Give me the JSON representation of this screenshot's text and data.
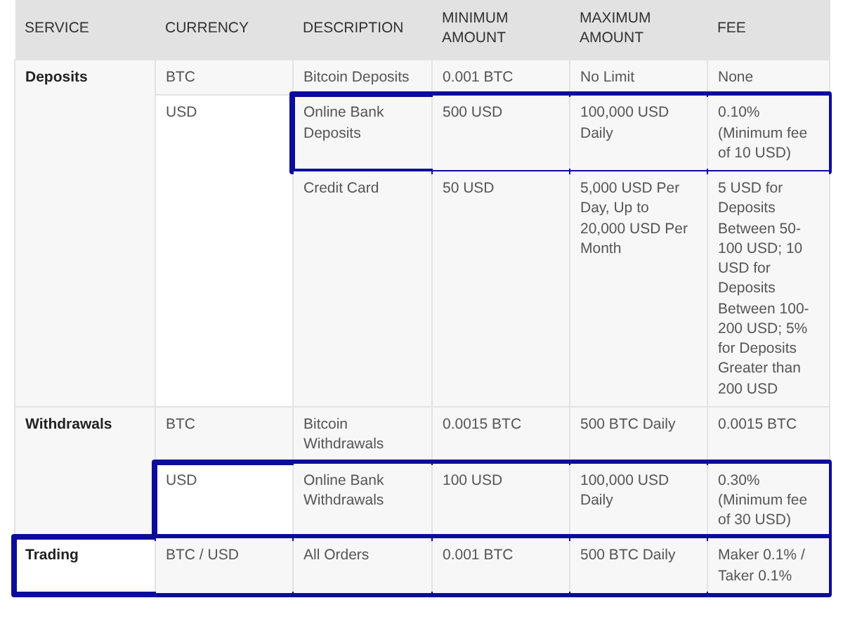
{
  "table": {
    "columns": [
      "SERVICE",
      "CURRENCY",
      "DESCRIPTION",
      "MINIMUM AMOUNT",
      "MAXIMUM AMOUNT",
      "FEE"
    ],
    "services": [
      {
        "name": "Deposits",
        "highlighted": false,
        "groups": [
          {
            "currency": "BTC",
            "highlighted": false,
            "entries": [
              {
                "description": "Bitcoin Deposits",
                "minimum": "0.001 BTC",
                "maximum": "No Limit",
                "fee": "None",
                "highlighted": false
              }
            ]
          },
          {
            "currency": "USD",
            "highlighted": false,
            "entries": [
              {
                "description": "Online Bank Deposits",
                "minimum": "500 USD",
                "maximum": "100,000 USD Daily",
                "fee": "0.10% (Minimum fee of 10 USD)",
                "highlighted": true
              },
              {
                "description": "Credit Card",
                "minimum": "50 USD",
                "maximum": "5,000 USD Per Day, Up to 20,000 USD Per Month",
                "fee": "5 USD for Deposits Between 50-100 USD; 10 USD for Deposits Between 100-200 USD; 5% for Deposits Greater than 200 USD",
                "highlighted": false
              }
            ]
          }
        ]
      },
      {
        "name": "Withdrawals",
        "highlighted": false,
        "groups": [
          {
            "currency": "BTC",
            "highlighted": false,
            "entries": [
              {
                "description": "Bitcoin Withdrawals",
                "minimum": "0.0015 BTC",
                "maximum": "500 BTC Daily",
                "fee": "0.0015 BTC",
                "highlighted": false
              }
            ]
          },
          {
            "currency": "USD",
            "highlighted": true,
            "entries": [
              {
                "description": "Online Bank Withdrawals",
                "minimum": "100 USD",
                "maximum": "100,000 USD Daily",
                "fee": "0.30% (Minimum fee of 30 USD)",
                "highlighted": false
              }
            ]
          }
        ]
      },
      {
        "name": "Trading",
        "highlighted": true,
        "groups": [
          {
            "currency": "BTC / USD",
            "highlighted": false,
            "entries": [
              {
                "description": "All Orders",
                "minimum": "0.001 BTC",
                "maximum": "500 BTC Daily",
                "fee": "Maker 0.1% / Taker 0.1%",
                "highlighted": false
              }
            ]
          }
        ]
      }
    ]
  }
}
